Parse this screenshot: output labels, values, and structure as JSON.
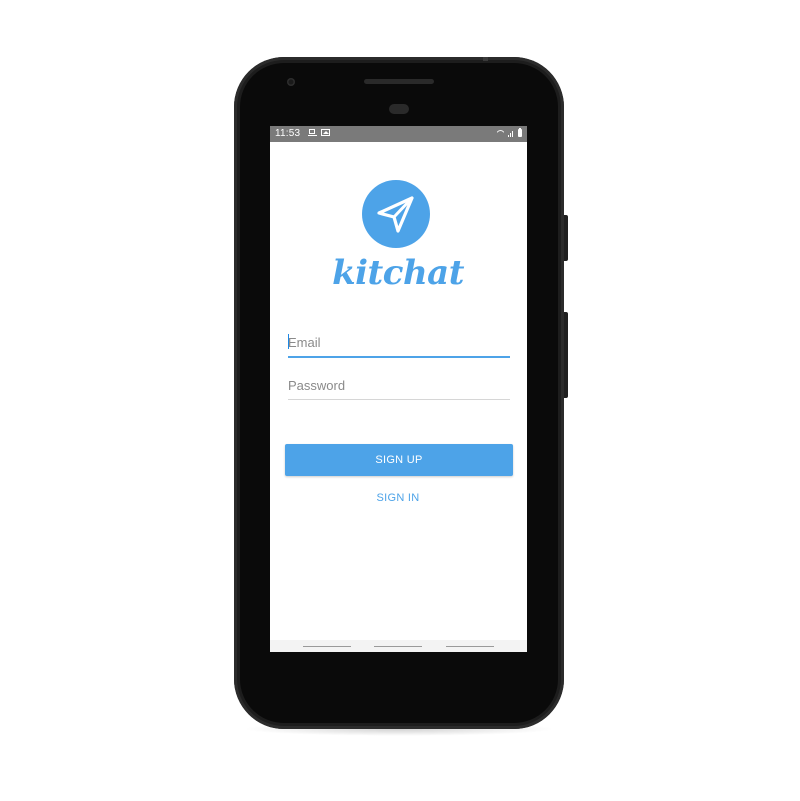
{
  "status_bar": {
    "time": "11:53"
  },
  "app": {
    "name": "kitchat",
    "accent_color": "#4da3e8"
  },
  "form": {
    "email": {
      "placeholder": "Email",
      "value": ""
    },
    "password": {
      "placeholder": "Password",
      "value": ""
    }
  },
  "buttons": {
    "signup_label": "SIGN UP",
    "signin_label": "SIGN IN"
  },
  "icons": {
    "logo": "paper-plane-icon",
    "status_left": [
      "laptop-icon",
      "image-icon"
    ],
    "status_right": [
      "wifi-icon",
      "signal-icon",
      "battery-icon"
    ]
  }
}
